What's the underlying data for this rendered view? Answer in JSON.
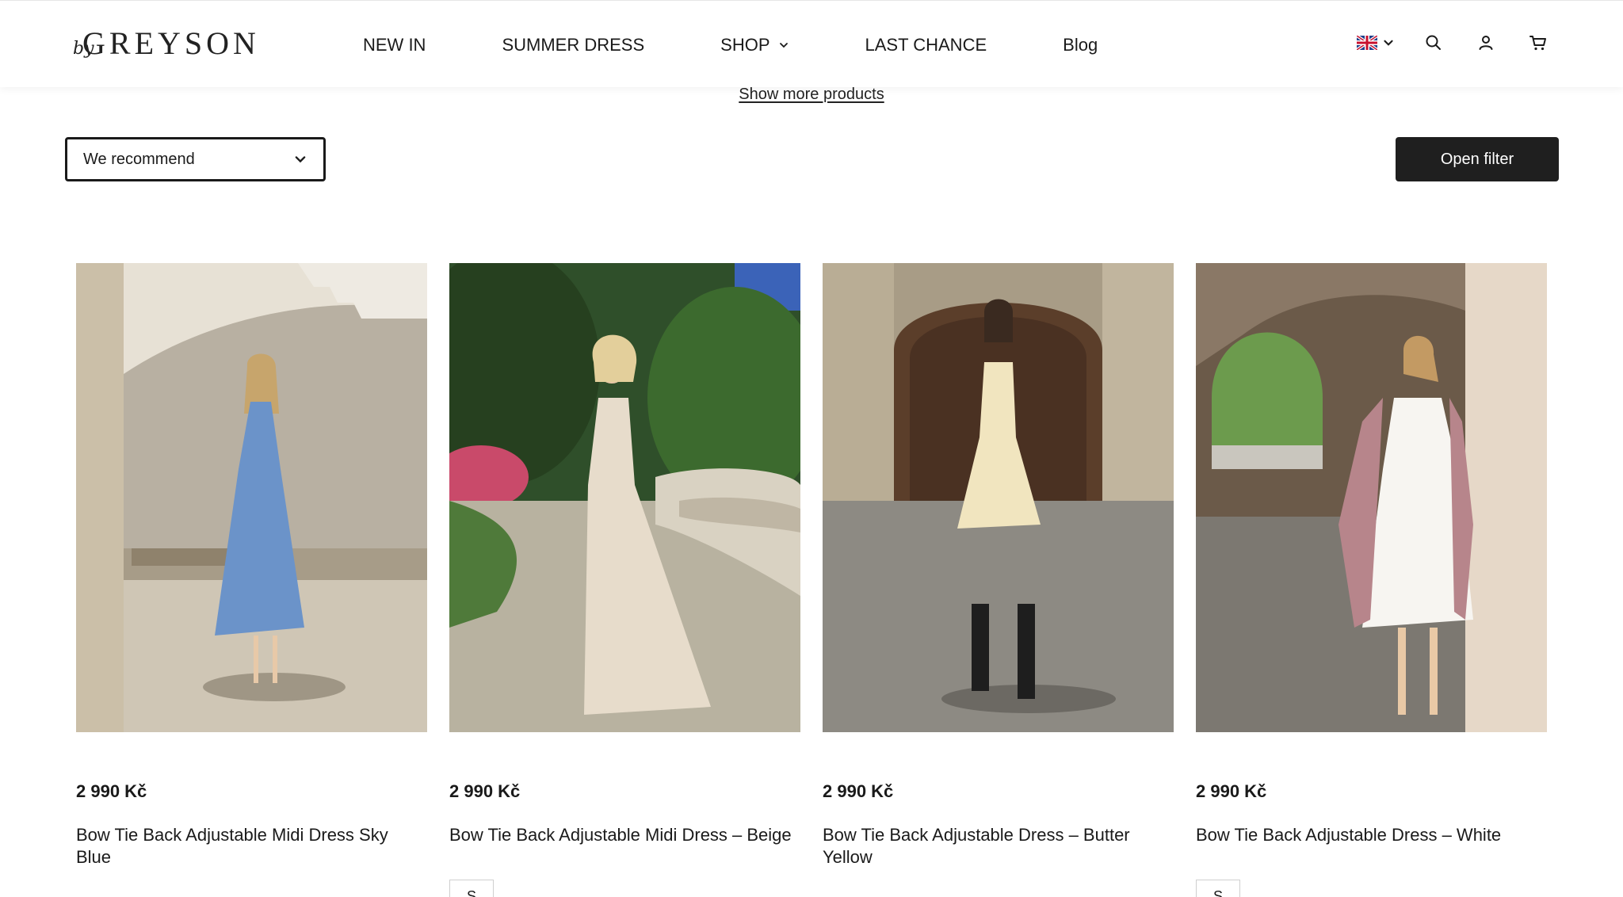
{
  "brand": {
    "by": "by",
    "name": "GREYSON"
  },
  "nav": [
    {
      "label": "NEW IN"
    },
    {
      "label": "SUMMER DRESS"
    },
    {
      "label": "SHOP"
    },
    {
      "label": "LAST CHANCE"
    },
    {
      "label": "Blog"
    }
  ],
  "header_icons": [
    "uk-flag-icon",
    "chevron-down-icon",
    "search-icon",
    "user-icon",
    "cart-icon"
  ],
  "show_more": "Show more products",
  "sort": {
    "selected": "We recommend"
  },
  "filter_button": "Open filter",
  "products": [
    {
      "price": "2 990 Kč",
      "name": "Bow Tie Back Adjustable Midi Dress Sky Blue",
      "size": "",
      "dress_color": "#6b93c9"
    },
    {
      "price": "2 990 Kč",
      "name": "Bow Tie Back Adjustable Midi Dress – Beige",
      "size": "S",
      "dress_color": "#e7dccb"
    },
    {
      "price": "2 990 Kč",
      "name": "Bow Tie Back Adjustable Dress – Butter Yellow",
      "size": "",
      "dress_color": "#f1e5bf"
    },
    {
      "price": "2 990 Kč",
      "name": "Bow Tie Back Adjustable Dress – White",
      "size": "S",
      "dress_color": "#f7f5f1"
    }
  ]
}
